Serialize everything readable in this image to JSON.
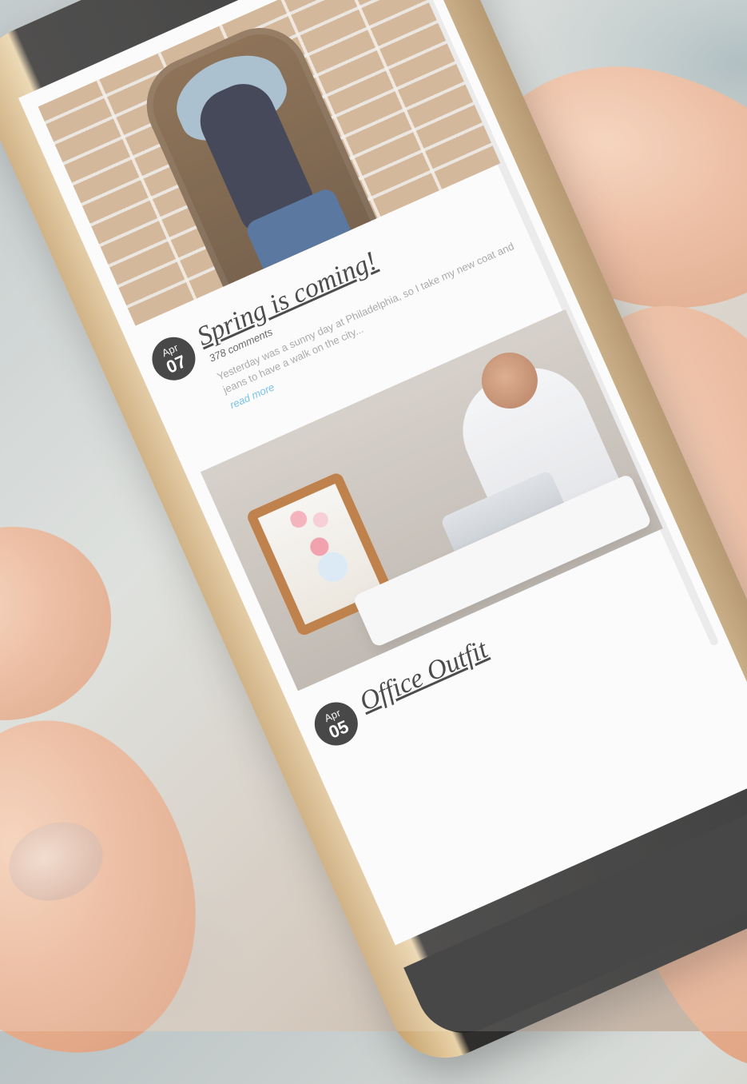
{
  "posts": [
    {
      "date": {
        "month": "Apr",
        "day": "07"
      },
      "title": "Spring is coming!",
      "comments": "378 comments",
      "excerpt": "Yesterday was a sunny day at Philadelphia, so I take my new coat and jeans to have a walk on the city...",
      "read_more": "read more"
    },
    {
      "date": {
        "month": "Apr",
        "day": "05"
      },
      "title": "Office Outfit"
    }
  ]
}
